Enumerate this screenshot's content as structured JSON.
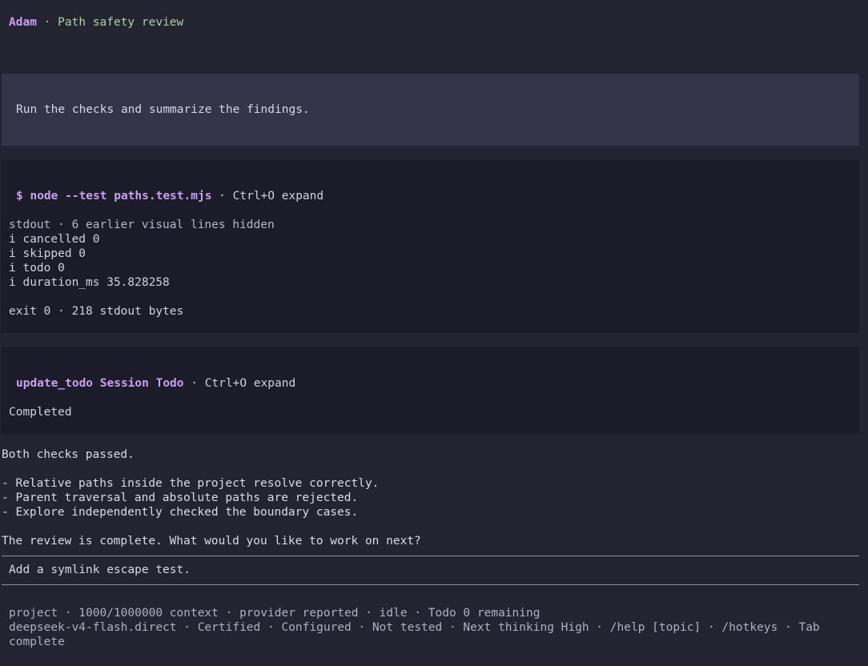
{
  "header": {
    "agent": "Adam",
    "separator": " · ",
    "session_title": "Path safety review"
  },
  "user_prompt": "Run the checks and summarize the findings.",
  "tools": {
    "node_test": {
      "command": "$ node --test paths.test.mjs",
      "hint": " · Ctrl+O expand",
      "stdout_note": "stdout · 6 earlier visual lines hidden",
      "lines": [
        "i cancelled 0",
        "i skipped 0",
        "i todo 0",
        "i duration_ms 35.828258"
      ],
      "exit_note": "exit 0 · 218 stdout bytes"
    },
    "update_todo": {
      "command": "update_todo Session Todo",
      "hint": " · Ctrl+O expand",
      "result": "Completed"
    }
  },
  "reply": {
    "lines": [
      "Both checks passed.",
      "",
      "- Relative paths inside the project resolve correctly.",
      "- Parent traversal and absolute paths are rejected.",
      "- Explore independently checked the boundary cases.",
      "",
      "The review is complete. What would you like to work on next?"
    ]
  },
  "composer": {
    "value": "Add a symlink escape test."
  },
  "status": {
    "line1": "project · 1000/1000000 context · provider reported · idle · Todo 0 remaining",
    "line2": "deepseek-v4-flash.direct · Certified · Configured · Not tested · Next thinking High · /help [topic] · /hotkeys · Tab",
    "line3": "complete"
  }
}
